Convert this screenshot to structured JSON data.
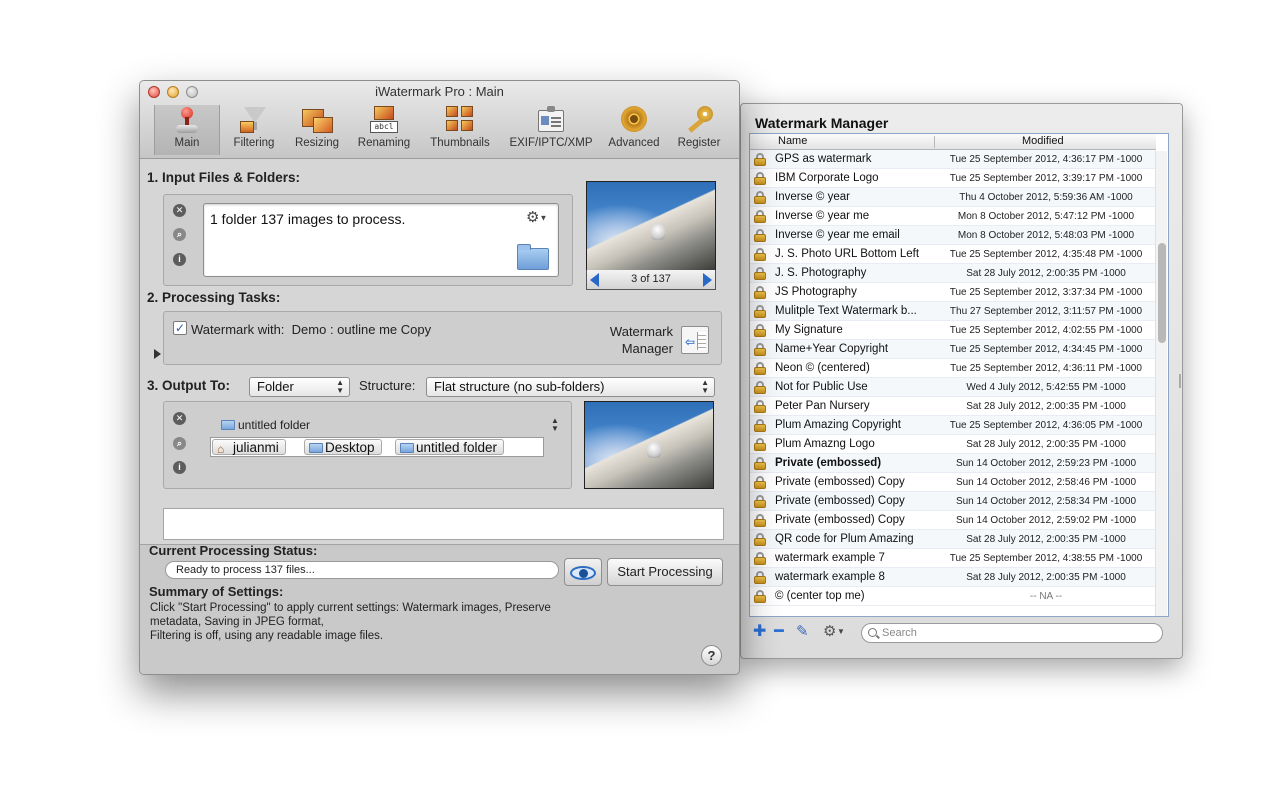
{
  "main_window": {
    "title": "iWatermark Pro : Main",
    "toolbar": [
      {
        "label": "Main",
        "icon": "lever-icon"
      },
      {
        "label": "Filtering",
        "icon": "funnel-icon"
      },
      {
        "label": "Resizing",
        "icon": "resize-icon"
      },
      {
        "label": "Renaming",
        "icon": "rename-icon"
      },
      {
        "label": "Thumbnails",
        "icon": "thumbnails-icon"
      },
      {
        "label": "EXIF/IPTC/XMP",
        "icon": "metadata-icon"
      },
      {
        "label": "Advanced",
        "icon": "gear-icon"
      },
      {
        "label": "Register",
        "icon": "key-icon"
      }
    ],
    "input": {
      "heading": "1. Input Files & Folders:",
      "summary": "1 folder 137 images to process.",
      "nav_text": "3 of 137"
    },
    "tasks": {
      "heading": "2. Processing Tasks:",
      "checkbox_checked": true,
      "watermark_with_label": "Watermark with:",
      "watermark_value": "Demo : outline me Copy",
      "manager_label_line1": "Watermark",
      "manager_label_line2": "Manager"
    },
    "output": {
      "heading": "3. Output To:",
      "destination": "Folder",
      "structure_label": "Structure:",
      "structure": "Flat structure (no sub-folders)",
      "folder_name": "untitled folder",
      "path": [
        "julianmi",
        "Desktop",
        "untitled folder"
      ]
    },
    "status": {
      "heading": "Current Processing Status:",
      "text": "Ready to process 137 files...",
      "start_label": "Start Processing"
    },
    "summary": {
      "heading": "Summary of Settings:",
      "lines": [
        "Click \"Start Processing\" to apply current settings: Watermark images, Preserve",
        "metadata, Saving in JPEG format,",
        "Filtering is off, using any readable image files."
      ]
    },
    "help_label": "?"
  },
  "watermark_manager": {
    "title": "Watermark Manager",
    "columns": [
      "Name",
      "Modified"
    ],
    "rows": [
      {
        "name": "GPS as watermark",
        "modified": "Tue 25 September 2012,  4:36:17 PM -1000",
        "bold": false
      },
      {
        "name": "IBM Corporate Logo",
        "modified": "Tue 25 September 2012,  3:39:17 PM -1000",
        "bold": false
      },
      {
        "name": "Inverse © year",
        "modified": "Thu 4 October 2012,  5:59:36 AM -1000",
        "bold": false
      },
      {
        "name": "Inverse © year me",
        "modified": "Mon 8 October 2012,  5:47:12 PM -1000",
        "bold": false
      },
      {
        "name": "Inverse © year me email",
        "modified": "Mon 8 October 2012,  5:48:03 PM -1000",
        "bold": false
      },
      {
        "name": "J. S. Photo URL Bottom Left",
        "modified": "Tue 25 September 2012,  4:35:48 PM -1000",
        "bold": false
      },
      {
        "name": "J. S. Photography",
        "modified": "Sat 28 July 2012,  2:00:35 PM -1000",
        "bold": false
      },
      {
        "name": "JS Photography",
        "modified": "Tue 25 September 2012,  3:37:34 PM -1000",
        "bold": false
      },
      {
        "name": "Mulitple Text Watermark b...",
        "modified": "Thu 27 September 2012,  3:11:57 PM -1000",
        "bold": false
      },
      {
        "name": "My Signature",
        "modified": "Tue 25 September 2012,  4:02:55 PM -1000",
        "bold": false
      },
      {
        "name": "Name+Year Copyright",
        "modified": "Tue 25 September 2012,  4:34:45 PM -1000",
        "bold": false
      },
      {
        "name": "Neon © (centered)",
        "modified": "Tue 25 September 2012,  4:36:11 PM -1000",
        "bold": false
      },
      {
        "name": "Not for Public Use",
        "modified": "Wed 4 July 2012,  5:42:55 PM -1000",
        "bold": false
      },
      {
        "name": "Peter Pan Nursery",
        "modified": "Sat 28 July 2012,  2:00:35 PM -1000",
        "bold": false
      },
      {
        "name": "Plum Amazing Copyright",
        "modified": "Tue 25 September 2012,  4:36:05 PM -1000",
        "bold": false
      },
      {
        "name": "Plum Amazng Logo",
        "modified": "Sat 28 July 2012,  2:00:35 PM -1000",
        "bold": false
      },
      {
        "name": "Private (embossed)",
        "modified": "Sun 14 October 2012,  2:59:23 PM -1000",
        "bold": true
      },
      {
        "name": "Private (embossed) Copy",
        "modified": "Sun 14 October 2012,  2:58:46 PM -1000",
        "bold": false
      },
      {
        "name": "Private (embossed) Copy",
        "modified": "Sun 14 October 2012,  2:58:34 PM -1000",
        "bold": false
      },
      {
        "name": "Private (embossed) Copy",
        "modified": "Sun 14 October 2012,  2:59:02 PM -1000",
        "bold": false
      },
      {
        "name": "QR code for Plum Amazing",
        "modified": "Sat 28 July 2012,  2:00:35 PM -1000",
        "bold": false
      },
      {
        "name": "watermark example 7",
        "modified": "Tue 25 September 2012,  4:38:55 PM -1000",
        "bold": false
      },
      {
        "name": "watermark example 8",
        "modified": "Sat 28 July 2012,  2:00:35 PM -1000",
        "bold": false
      },
      {
        "name": "© (center top me)",
        "modified": "-- NA --",
        "bold": false
      }
    ],
    "search_placeholder": "Search"
  },
  "colors": {
    "accent": "#2a68c8",
    "lock": "#e0a531",
    "window_bg": "#d6d6d6"
  }
}
